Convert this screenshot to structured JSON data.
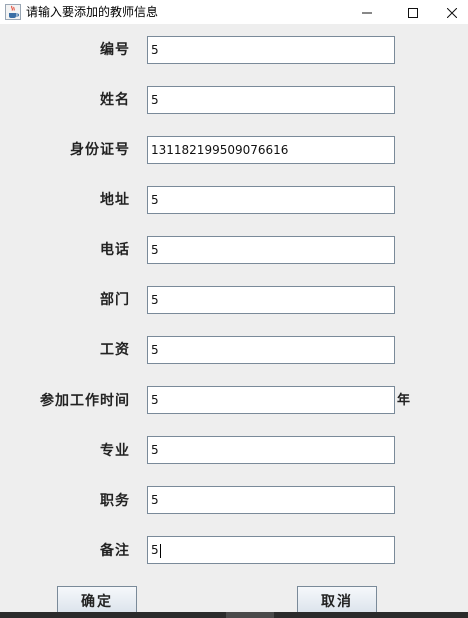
{
  "window": {
    "title": "请输入要添加的教师信息",
    "icon": "java-cup-icon",
    "controls": [
      "minimize-icon",
      "maximize-icon",
      "close-icon"
    ]
  },
  "form": {
    "fields": [
      {
        "label": "编号",
        "value": "5"
      },
      {
        "label": "姓名",
        "value": "5"
      },
      {
        "label": "身份证号",
        "value": "131182199509076616"
      },
      {
        "label": "地址",
        "value": "5"
      },
      {
        "label": "电话",
        "value": "5"
      },
      {
        "label": "部门",
        "value": "5"
      },
      {
        "label": "工资",
        "value": "5"
      },
      {
        "label": "参加工作时间",
        "value": "5",
        "suffix": "年"
      },
      {
        "label": "专业",
        "value": "5"
      },
      {
        "label": "职务",
        "value": "5"
      },
      {
        "label": "备注",
        "value": "5"
      }
    ]
  },
  "buttons": {
    "confirm": "确定",
    "cancel": "取消"
  }
}
